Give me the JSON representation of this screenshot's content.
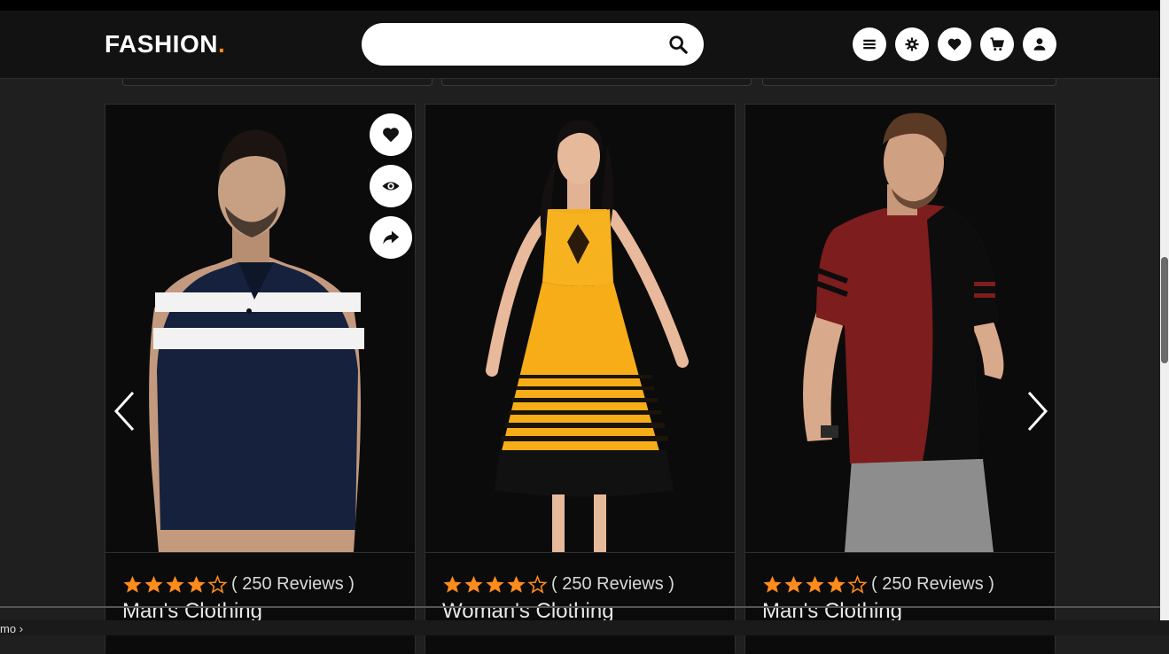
{
  "header": {
    "logo_text": "FASHION",
    "logo_dot": ".",
    "brand_accent": "#ff8c1a",
    "search_placeholder": ""
  },
  "header_icons": [
    "menu-icon",
    "gear-icon",
    "heart-icon",
    "cart-icon",
    "user-icon"
  ],
  "card_actions": [
    "heart-icon",
    "eye-icon",
    "share-icon"
  ],
  "products": [
    {
      "name": "Man's Clothing",
      "reviews": "( 250 Reviews )",
      "rating": 4,
      "max_rating": 5
    },
    {
      "name": "Woman's Clothing",
      "reviews": "( 250 Reviews )",
      "rating": 4,
      "max_rating": 5
    },
    {
      "name": "Man's Clothing",
      "reviews": "( 250 Reviews )",
      "rating": 4,
      "max_rating": 5
    }
  ],
  "bottom": {
    "text": "mo"
  },
  "colors": {
    "star": "#ff8c1a",
    "background": "#1f1f1f",
    "card": "#0b0b0b"
  }
}
